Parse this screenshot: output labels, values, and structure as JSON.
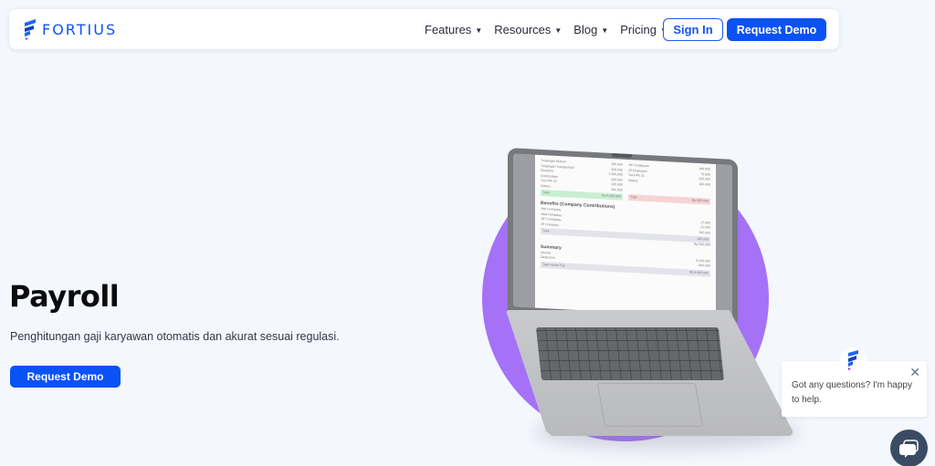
{
  "brand": {
    "name": "FORTIUS",
    "logo_icon": "fortius-logo-icon",
    "primary_color": "#0a52f5",
    "accent_color": "#a572f7"
  },
  "nav": {
    "items": [
      {
        "label": "Features",
        "icon": "chevron-down-icon"
      },
      {
        "label": "Resources",
        "icon": "chevron-down-icon"
      },
      {
        "label": "Blog",
        "icon": "chevron-down-icon"
      },
      {
        "label": "Pricing",
        "icon": "chevron-down-icon"
      }
    ],
    "sign_in": "Sign In",
    "request_demo": "Request Demo"
  },
  "hero": {
    "title": "Payroll",
    "subtitle": "Penghitungan gaji karyawan otomatis dan akurat sesuai regulasi.",
    "cta": "Request Demo"
  },
  "laptop_screen": {
    "income_rows": [
      {
        "label": "Tunjangan Makan",
        "value": "200.000"
      },
      {
        "label": "Tunjangan Transportasi",
        "value": "500.000"
      },
      {
        "label": "Overtime",
        "value": "1.200.000"
      },
      {
        "label": "Commission",
        "value": "100.000"
      },
      {
        "label": "Tax PPh 21",
        "value": "220.000"
      },
      {
        "label": "Others",
        "value": "300.000"
      }
    ],
    "income_total": {
      "label": "Total",
      "value": "Rp 9.520.000"
    },
    "deduction_rows": [
      {
        "label": "JHT Employee",
        "value": "140.000"
      },
      {
        "label": "JP Employee",
        "value": "76.000"
      },
      {
        "label": "Tax PPh 21",
        "value": "220.000"
      },
      {
        "label": "Others",
        "value": "180.000"
      }
    ],
    "deduction_total": {
      "label": "Total",
      "value": "Rp 695.000"
    },
    "benefits_title": "Benefits (Company Contributions)",
    "benefit_rows": [
      {
        "label": "JKK Company",
        "value": ""
      },
      {
        "label": "JKM Company",
        "value": "17.900"
      },
      {
        "label": "JHT Company",
        "value": "21.000"
      },
      {
        "label": "JP Company",
        "value": "342.000"
      }
    ],
    "benefits_total": {
      "label": "Total",
      "value": "140.000"
    },
    "benefits_grand": "Rp 540.800",
    "summary_title": "Summary",
    "summary_rows": [
      {
        "label": "Income",
        "value": "9.520.000"
      },
      {
        "label": "Deduction",
        "value": "- 695.000"
      }
    ],
    "take_home": {
      "label": "Take Home Pay",
      "value": "Rp 8.835.000"
    }
  },
  "chat": {
    "message": "Got any questions? I'm happy to help.",
    "close_icon": "close-icon",
    "launcher_icon": "chat-bubble-icon"
  }
}
